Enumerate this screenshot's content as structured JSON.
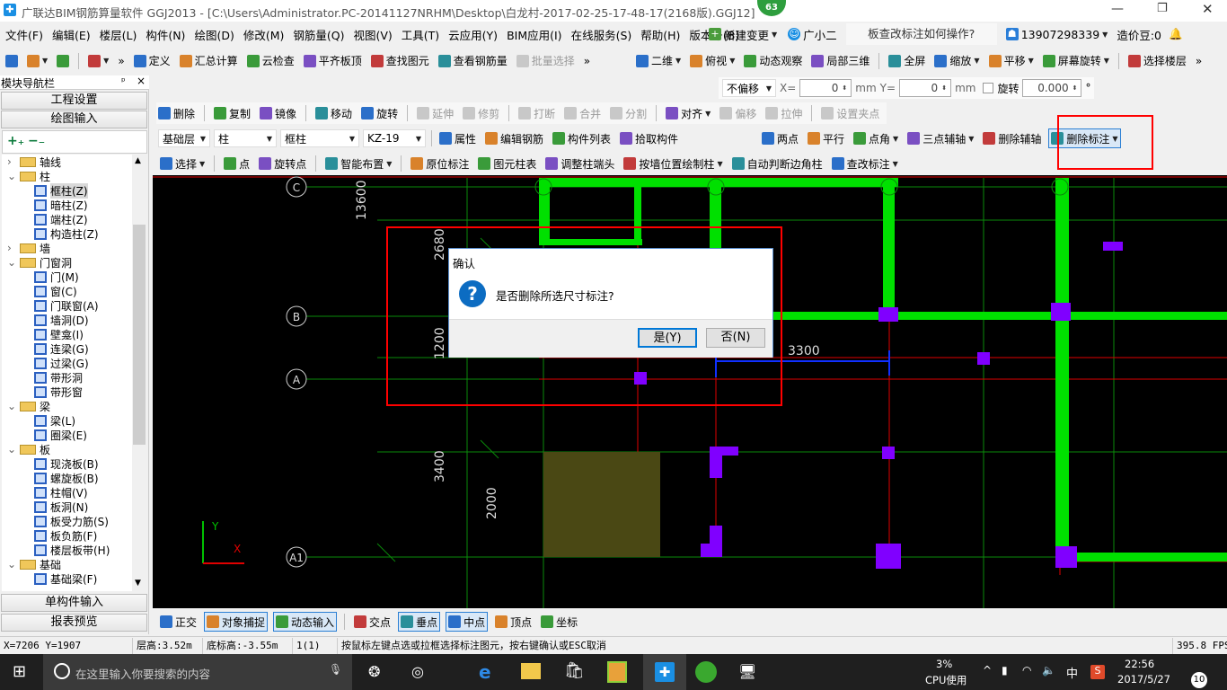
{
  "app": {
    "title": "广联达BIM钢筋算量软件 GGJ2013 - [C:\\Users\\Administrator.PC-20141127NRHM\\Desktop\\白龙村-2017-02-25-17-48-17(2168版).GGJ12]",
    "badge": "63",
    "accent": "#0078d7"
  },
  "menu": {
    "items": [
      "文件(F)",
      "编辑(E)",
      "楼层(L)",
      "构件(N)",
      "绘图(D)",
      "修改(M)",
      "钢筋量(Q)",
      "视图(V)",
      "工具(T)",
      "云应用(Y)",
      "BIM应用(I)",
      "在线服务(S)",
      "帮助(H)",
      "版本号(B)"
    ],
    "new_change": "新建变更",
    "assistant": "广小二",
    "help_query": "板查改标注如何操作?",
    "user": "13907298339",
    "beans": "造价豆:0"
  },
  "toolbar1": [
    {
      "icon": "new-file",
      "label": ""
    },
    {
      "icon": "open-folder",
      "label": "",
      "dd": true
    },
    {
      "icon": "save",
      "label": ""
    },
    {
      "sep": true
    },
    {
      "icon": "undo",
      "label": "",
      "dd": true
    },
    {
      "icon": "more",
      "label": "»"
    },
    {
      "icon": "define",
      "label": "定义"
    },
    {
      "icon": "sigma",
      "label": "汇总计算"
    },
    {
      "icon": "cloud-check",
      "label": "云检查"
    },
    {
      "icon": "align-slab-top",
      "label": "平齐板顶"
    },
    {
      "icon": "binoculars",
      "label": "查找图元"
    },
    {
      "icon": "view-rebar",
      "label": "查看钢筋量"
    },
    {
      "icon": "batch-select",
      "label": "批量选择",
      "dis": true
    },
    {
      "icon": "more",
      "label": "»"
    }
  ],
  "toolbar1b": [
    {
      "icon": "2d",
      "label": "二维",
      "dd": true
    },
    {
      "icon": "top-view",
      "label": "俯视",
      "dd": true
    },
    {
      "icon": "orbit",
      "label": "动态观察"
    },
    {
      "icon": "local-3d",
      "label": "局部三维"
    },
    {
      "sep": true
    },
    {
      "icon": "fullscreen",
      "label": "全屏"
    },
    {
      "icon": "zoom",
      "label": "缩放",
      "dd": true
    },
    {
      "icon": "pan",
      "label": "平移",
      "dd": true
    },
    {
      "icon": "screen-rotate",
      "label": "屏幕旋转",
      "dd": true
    },
    {
      "sep": true
    },
    {
      "icon": "select-floor",
      "label": "选择楼层"
    },
    {
      "icon": "more",
      "label": "»"
    }
  ],
  "offset": {
    "mode": "不偏移",
    "x_label": "X=",
    "x": "0",
    "y_label": "Y=",
    "y": "0",
    "unit": "mm",
    "rotate_label": "旋转",
    "rotate": "0.000",
    "deg": "°"
  },
  "edit_toolbar": [
    {
      "icon": "eraser",
      "label": "删除"
    },
    {
      "sep": true
    },
    {
      "icon": "copy",
      "label": "复制"
    },
    {
      "icon": "mirror",
      "label": "镜像"
    },
    {
      "sep": true
    },
    {
      "icon": "move",
      "label": "移动"
    },
    {
      "icon": "rotate",
      "label": "旋转"
    },
    {
      "sep": true
    },
    {
      "icon": "extend",
      "label": "延伸",
      "dis": true
    },
    {
      "icon": "trim",
      "label": "修剪",
      "dis": true
    },
    {
      "sep": true
    },
    {
      "icon": "break",
      "label": "打断",
      "dis": true
    },
    {
      "icon": "merge",
      "label": "合并",
      "dis": true
    },
    {
      "icon": "split",
      "label": "分割",
      "dis": true
    },
    {
      "sep": true
    },
    {
      "icon": "align",
      "label": "对齐",
      "dd": true
    },
    {
      "icon": "offset",
      "label": "偏移",
      "dis": true
    },
    {
      "icon": "stretch",
      "label": "拉伸",
      "dis": true
    },
    {
      "sep": true
    },
    {
      "icon": "set-grip",
      "label": "设置夹点",
      "dis": true
    }
  ],
  "component": {
    "floor": "基础层",
    "type": "柱",
    "subtype": "框柱",
    "name": "KZ-19",
    "actions": [
      {
        "icon": "properties",
        "label": "属性"
      },
      {
        "icon": "edit-rebar",
        "label": "编辑钢筋"
      },
      {
        "icon": "component-list",
        "label": "构件列表"
      },
      {
        "icon": "pick",
        "label": "拾取构件"
      }
    ]
  },
  "axis_toolbar": [
    {
      "icon": "two-point",
      "label": "两点"
    },
    {
      "icon": "parallel",
      "label": "平行"
    },
    {
      "icon": "point-angle",
      "label": "点角",
      "dd": true
    },
    {
      "icon": "three-point-axis",
      "label": "三点辅轴",
      "dd": true
    },
    {
      "icon": "delete-axis",
      "label": "删除辅轴"
    },
    {
      "icon": "delete-dimension",
      "label": "删除标注",
      "act": true,
      "dd": true
    }
  ],
  "draw_toolbar": [
    {
      "icon": "cursor",
      "label": "选择",
      "dd": true
    },
    {
      "sep": true
    },
    {
      "icon": "point",
      "label": "点"
    },
    {
      "icon": "rotate-point",
      "label": "旋转点"
    },
    {
      "sep": true
    },
    {
      "icon": "smart-layout",
      "label": "智能布置",
      "dd": true
    },
    {
      "sep": true
    },
    {
      "icon": "in-place-label",
      "label": "原位标注"
    },
    {
      "icon": "column-table",
      "label": "图元柱表"
    },
    {
      "icon": "adjust-column-end",
      "label": "调整柱端头"
    },
    {
      "icon": "draw-by-wall",
      "label": "按墙位置绘制柱",
      "dd": true
    },
    {
      "icon": "auto-corner",
      "label": "自动判断边角柱"
    },
    {
      "icon": "check-label",
      "label": "查改标注",
      "dd": true
    }
  ],
  "nav": {
    "title": "模块导航栏",
    "pin": "ᵖ",
    "close": "×",
    "project_settings": "工程设置",
    "drawing_input": "绘图输入",
    "single_input": "单构件输入",
    "report_preview": "报表预览",
    "tree": [
      {
        "label": "轴线",
        "folder": true,
        "open": false
      },
      {
        "label": "柱",
        "folder": true,
        "open": true
      },
      {
        "label": "框柱(Z)",
        "selected": true
      },
      {
        "label": "暗柱(Z)"
      },
      {
        "label": "端柱(Z)"
      },
      {
        "label": "构造柱(Z)"
      },
      {
        "label": "墙",
        "folder": true,
        "open": false
      },
      {
        "label": "门窗洞",
        "folder": true,
        "open": true
      },
      {
        "label": "门(M)"
      },
      {
        "label": "窗(C)"
      },
      {
        "label": "门联窗(A)"
      },
      {
        "label": "墙洞(D)"
      },
      {
        "label": "壁龛(I)"
      },
      {
        "label": "连梁(G)"
      },
      {
        "label": "过梁(G)"
      },
      {
        "label": "带形洞"
      },
      {
        "label": "带形窗"
      },
      {
        "label": "梁",
        "folder": true,
        "open": true
      },
      {
        "label": "梁(L)"
      },
      {
        "label": "圈梁(E)"
      },
      {
        "label": "板",
        "folder": true,
        "open": true
      },
      {
        "label": "现浇板(B)"
      },
      {
        "label": "螺旋板(B)"
      },
      {
        "label": "柱帽(V)"
      },
      {
        "label": "板洞(N)"
      },
      {
        "label": "板受力筋(S)"
      },
      {
        "label": "板负筋(F)"
      },
      {
        "label": "楼层板带(H)"
      },
      {
        "label": "基础",
        "folder": true,
        "open": true
      },
      {
        "label": "基础梁(F)"
      }
    ]
  },
  "canvas": {
    "axes": [
      "C",
      "B",
      "A",
      "A1"
    ],
    "dims": {
      "d13600": "13600",
      "d2680": "2680",
      "d1200": "1200",
      "d3400": "3400",
      "d2000": "2000",
      "d3300": "3300"
    },
    "ucs_x": "X",
    "ucs_y": "Y"
  },
  "dialog": {
    "title": "确认",
    "message": "是否删除所选尺寸标注?",
    "yes": "是(Y)",
    "no": "否(N)"
  },
  "snap_toolbar": [
    {
      "icon": "ortho",
      "label": "正交"
    },
    {
      "icon": "object-snap",
      "label": "对象捕捉",
      "act": true
    },
    {
      "icon": "dynamic-input",
      "label": "动态输入",
      "act": true
    },
    {
      "sep": true
    },
    {
      "icon": "intersection",
      "label": "交点"
    },
    {
      "icon": "perpendicular",
      "label": "垂点",
      "act": true
    },
    {
      "icon": "midpoint",
      "label": "中点",
      "act": true
    },
    {
      "icon": "vertex",
      "label": "顶点"
    },
    {
      "icon": "coordinate",
      "label": "坐标"
    }
  ],
  "status": {
    "coords": "X=7206 Y=1907",
    "floor_height": "层高:3.52m",
    "base_elevation": "底标高:-3.55m",
    "count": "1(1)",
    "hint": "按鼠标左键点选或拉框选择标注图元，按右键确认或ESC取消",
    "fps": "395.8 FPS"
  },
  "taskbar": {
    "search_placeholder": "在这里输入你要搜索的内容",
    "cpu": "3%",
    "cpu_label": "CPU使用",
    "ime": "中",
    "time": "22:56",
    "date": "2017/5/27",
    "notifications": "10"
  }
}
